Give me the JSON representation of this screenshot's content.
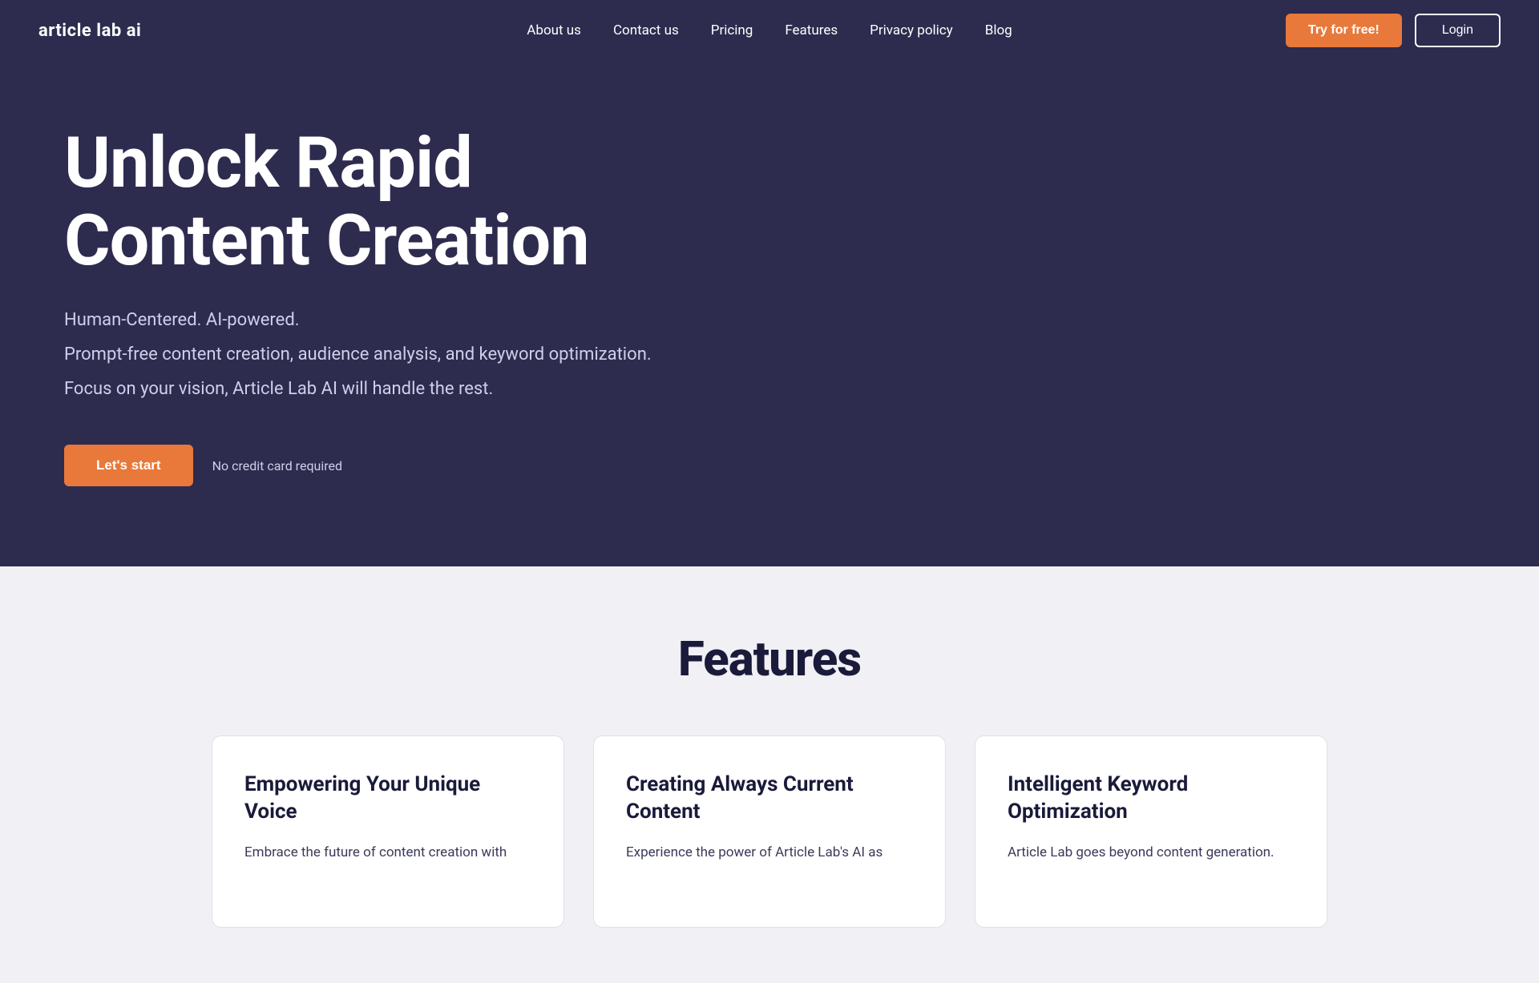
{
  "brand": {
    "logo": "article lab ai"
  },
  "navbar": {
    "links": [
      {
        "label": "About us",
        "id": "about-us"
      },
      {
        "label": "Contact us",
        "id": "contact-us"
      },
      {
        "label": "Pricing",
        "id": "pricing"
      },
      {
        "label": "Features",
        "id": "features"
      },
      {
        "label": "Privacy policy",
        "id": "privacy-policy"
      },
      {
        "label": "Blog",
        "id": "blog"
      }
    ],
    "try_free_label": "Try for free!",
    "login_label": "Login"
  },
  "hero": {
    "title": "Unlock Rapid Content Creation",
    "subtitle_line1": "Human-Centered. AI-powered.",
    "subtitle_line2": "Prompt-free content creation, audience analysis, and keyword optimization.",
    "subtitle_line3": "Focus on your vision, Article Lab AI will handle the rest.",
    "cta_button": "Let's start",
    "cta_note": "No credit card required"
  },
  "features": {
    "section_title": "Features",
    "cards": [
      {
        "id": "card-voice",
        "title": "Empowering Your Unique Voice",
        "description": "Embrace the future of content creation with"
      },
      {
        "id": "card-current",
        "title": "Creating Always Current Content",
        "description": "Experience the power of Article Lab's AI as"
      },
      {
        "id": "card-keyword",
        "title": "Intelligent Keyword Optimization",
        "description": "Article Lab goes beyond content generation."
      }
    ]
  }
}
